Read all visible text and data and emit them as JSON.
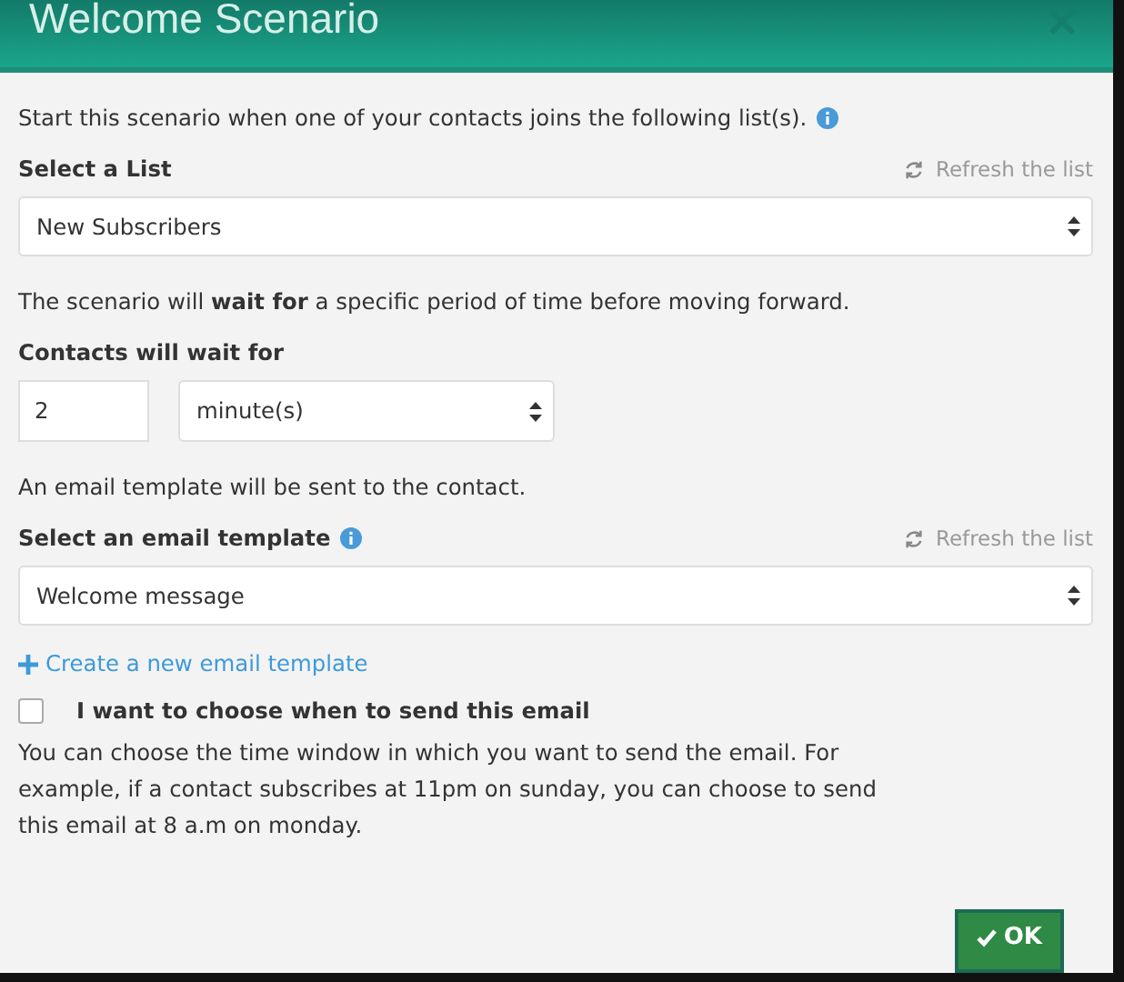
{
  "dialog": {
    "title": "Welcome Scenario"
  },
  "intro": "Start this scenario when one of your contacts joins the following list(s).",
  "list_section": {
    "label": "Select a List",
    "refresh": "Refresh the list",
    "value": "New Subscribers"
  },
  "wait_text": "The scenario will **wait for** a specific period of time before moving forward.",
  "wait_section": {
    "label": "Contacts will wait for",
    "amount": "2",
    "unit": "minute(s)"
  },
  "template_text": "An email template will be sent to the contact.",
  "template_section": {
    "label": "Select an email template",
    "refresh": "Refresh the list",
    "value": "Welcome message"
  },
  "create_link": "Create a new email template",
  "schedule": {
    "label": "I want to choose when to send this email",
    "checked": false
  },
  "schedule_help": "You can choose the time window in which you want to send the email. For example, if a contact subscribes at 11pm on sunday, you can choose to send this email at 8 a.m on monday.",
  "ok_button": "OK"
}
